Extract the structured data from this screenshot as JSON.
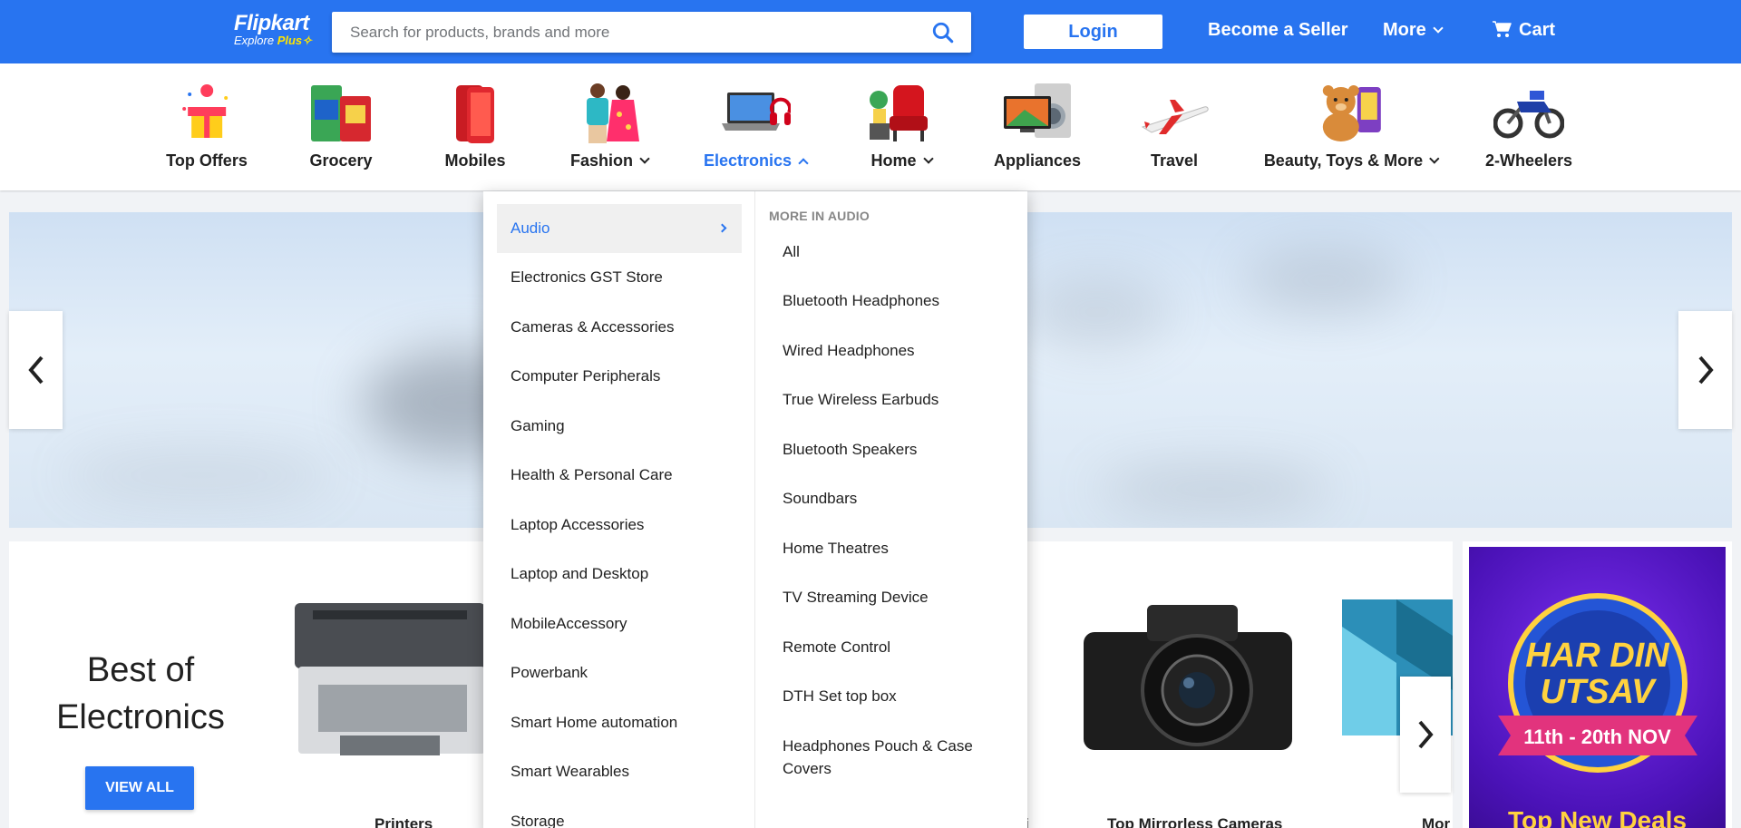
{
  "header": {
    "logo_name": "Flipkart",
    "logo_sub": "Explore",
    "logo_plus": "Plus",
    "search_placeholder": "Search for products, brands and more",
    "login": "Login",
    "seller": "Become a Seller",
    "more": "More",
    "cart": "Cart",
    "brand_color": "#2874f0"
  },
  "categories": [
    {
      "label": "Top Offers",
      "icon": "gift-icon"
    },
    {
      "label": "Grocery",
      "icon": "grocery-icon"
    },
    {
      "label": "Mobiles",
      "icon": "mobile-icon"
    },
    {
      "label": "Fashion",
      "icon": "fashion-icon",
      "dropdown": true
    },
    {
      "label": "Electronics",
      "icon": "laptop-icon",
      "dropdown": true,
      "active": true
    },
    {
      "label": "Home",
      "icon": "chair-icon",
      "dropdown": true
    },
    {
      "label": "Appliances",
      "icon": "appliances-icon"
    },
    {
      "label": "Travel",
      "icon": "airplane-icon"
    },
    {
      "label": "Beauty, Toys & More",
      "icon": "teddy-icon",
      "dropdown": true
    },
    {
      "label": "2-Wheelers",
      "icon": "motorbike-icon"
    }
  ],
  "dropdown": {
    "left": [
      "Audio",
      "Electronics GST Store",
      "Cameras & Accessories",
      "Computer Peripherals",
      "Gaming",
      "Health & Personal Care",
      "Laptop Accessories",
      "Laptop and Desktop",
      "MobileAccessory",
      "Powerbank",
      "Smart Home automation",
      "Smart Wearables",
      "Storage"
    ],
    "right_heading": "MORE IN AUDIO",
    "right": [
      "All",
      "Bluetooth Headphones",
      "Wired Headphones",
      "True Wireless Earbuds",
      "Bluetooth Speakers",
      "Soundbars",
      "Home Theatres",
      "TV Streaming Device",
      "Remote Control",
      "DTH Set top box",
      "Headphones Pouch & Case Covers"
    ]
  },
  "best": {
    "title_line1": "Best of",
    "title_line2": "Electronics",
    "view_all": "VIEW ALL",
    "products": [
      "Printers",
      "i",
      "Top Mirrorless Cameras",
      "Mor"
    ]
  },
  "promo": {
    "line1": "HAR DIN",
    "line2": "UTSAV",
    "dates": "11th - 20th NOV",
    "footer": "Top New Deals"
  }
}
